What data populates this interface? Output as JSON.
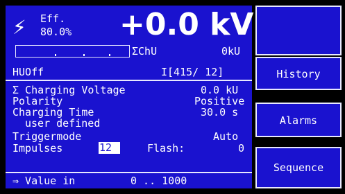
{
  "header": {
    "eff_label": "Eff.",
    "eff_value": "80.0%",
    "voltage": "+0.0 kV",
    "bar_label": "ΣChU",
    "bar_value": "0kU",
    "bar_fill_percent": 0,
    "status": "HUOff",
    "status_values": "I[415/ 12]"
  },
  "params": {
    "charging_voltage_label": "Σ Charging Voltage",
    "charging_voltage_value": "0.0 kU",
    "polarity_label": "Polarity",
    "polarity_value": "Positive",
    "charging_time_label": "Charging Time",
    "charging_time_value": "30.0 s",
    "user_defined_label": "user defined",
    "triggermode_label": "Triggermode",
    "triggermode_value": "Auto",
    "impulses_label": "Impulses",
    "impulses_value": "12",
    "flash_label": "Flash:",
    "flash_value": "0"
  },
  "footer": {
    "value_in": "⇒ Value in",
    "range": "0 .. 1000"
  },
  "buttons": {
    "top": "",
    "history": "History",
    "alarms": "Alarms",
    "sequence": "Sequence"
  },
  "colors": {
    "panel_blue": "#1a12cf",
    "text_white": "#ffffff"
  }
}
